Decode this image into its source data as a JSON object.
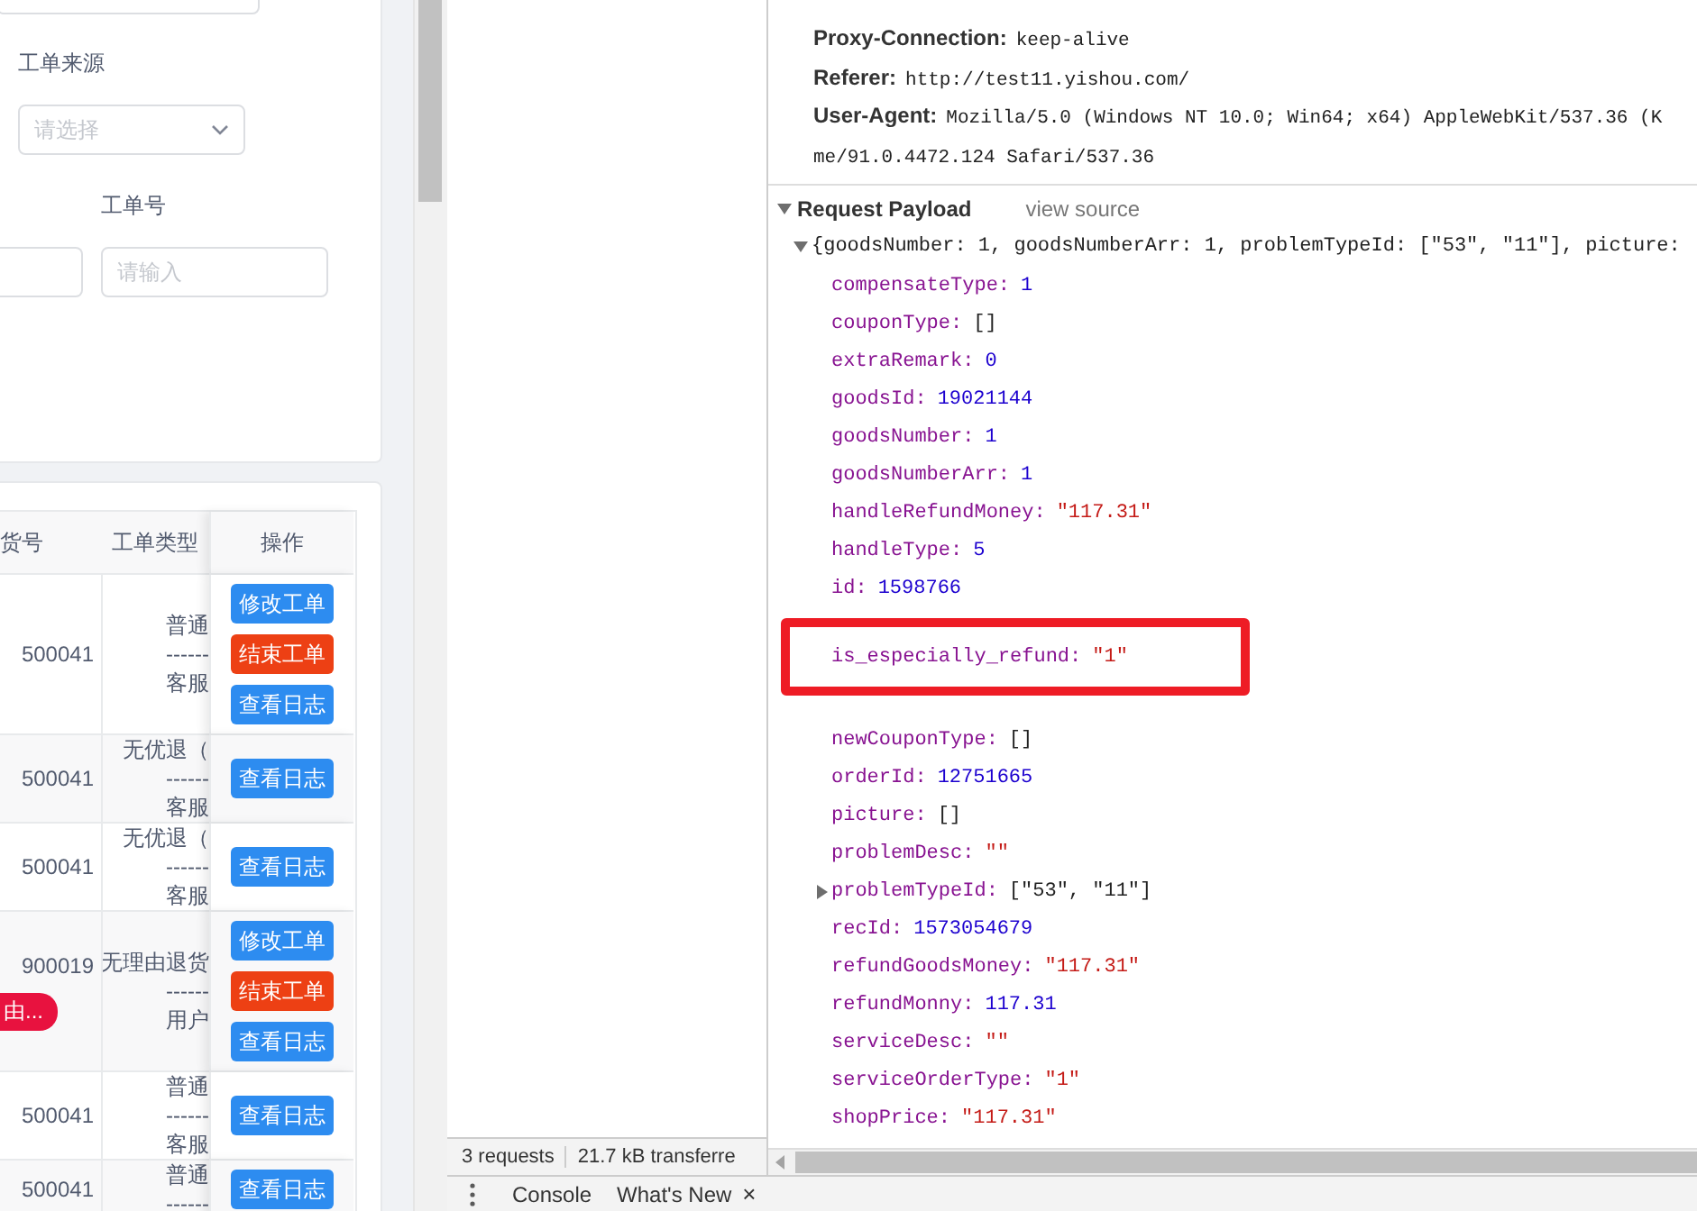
{
  "app": {
    "form": {
      "fields": [
        {
          "label": "工单来源",
          "placeholder": "请选择",
          "kind": "select"
        },
        {
          "label": "工单号",
          "placeholder": "请输入",
          "kind": "input"
        }
      ]
    },
    "table": {
      "columns": [
        "货号",
        "工单类型",
        "操作"
      ],
      "rows": [
        {
          "column_1": "500041",
          "type_lines": [
            "普通",
            "------",
            "客服"
          ],
          "actions": [
            {
              "label": "修改工单",
              "kind": "primary"
            },
            {
              "label": "结束工单",
              "kind": "danger"
            },
            {
              "label": "查看日志",
              "kind": "primary"
            }
          ]
        },
        {
          "column_1": "500041",
          "type_lines": [
            "无优退（",
            "------",
            "客服"
          ],
          "actions": [
            {
              "label": "查看日志",
              "kind": "primary"
            }
          ]
        },
        {
          "column_1": "500041",
          "type_lines": [
            "无优退（",
            "------",
            "客服"
          ],
          "actions": [
            {
              "label": "查看日志",
              "kind": "primary"
            }
          ]
        },
        {
          "column_1": "900019",
          "tag": "由...",
          "type_lines": [
            "无理由退货",
            "------",
            "用户"
          ],
          "actions": [
            {
              "label": "修改工单",
              "kind": "primary"
            },
            {
              "label": "结束工单",
              "kind": "danger"
            },
            {
              "label": "查看日志",
              "kind": "primary"
            }
          ]
        },
        {
          "column_1": "500041",
          "type_lines": [
            "普通",
            "------",
            "客服"
          ],
          "actions": [
            {
              "label": "查看日志",
              "kind": "primary"
            }
          ]
        },
        {
          "column_1": "500041",
          "type_lines": [
            "普通",
            "------"
          ],
          "actions": [
            {
              "label": "查看日志",
              "kind": "primary"
            }
          ]
        }
      ]
    }
  },
  "network": {
    "status_bar": [
      "3 requests",
      "21.7 kB transferre"
    ]
  },
  "headers": [
    {
      "key": "Proxy-Connection:",
      "value": "keep-alive"
    },
    {
      "key": "Referer:",
      "value": "http://test11.yishou.com/"
    },
    {
      "key": "User-Agent:",
      "value": "Mozilla/5.0 (Windows NT 10.0; Win64; x64) AppleWebKit/537.36 (K"
    },
    {
      "value": "me/91.0.4472.124 Safari/537.36"
    }
  ],
  "payload": {
    "title": "Request Payload",
    "link": "view source",
    "expanded": true,
    "summary": "{goodsNumber: 1, goodsNumberArr: 1, problemTypeId: [\"53\", \"11\"], picture:",
    "summary_expanded": true,
    "properties": [
      {
        "key": "compensateType:",
        "value": "1",
        "kind": "number",
        "expandable": false,
        "highlighted": false
      },
      {
        "key": "couponType:",
        "value": "[]",
        "kind": "array",
        "expandable": false,
        "highlighted": false
      },
      {
        "key": "extraRemark:",
        "value": "0",
        "kind": "number",
        "expandable": false,
        "highlighted": false
      },
      {
        "key": "goodsId:",
        "value": "19021144",
        "kind": "number",
        "expandable": false,
        "highlighted": false
      },
      {
        "key": "goodsNumber:",
        "value": "1",
        "kind": "number",
        "expandable": false,
        "highlighted": false
      },
      {
        "key": "goodsNumberArr:",
        "value": "1",
        "kind": "number",
        "expandable": false,
        "highlighted": false
      },
      {
        "key": "handleRefundMoney:",
        "value": "\"117.31\"",
        "kind": "string",
        "expandable": false,
        "highlighted": false
      },
      {
        "key": "handleType:",
        "value": "5",
        "kind": "number",
        "expandable": false,
        "highlighted": false
      },
      {
        "key": "id:",
        "value": "1598766",
        "kind": "number",
        "expandable": false,
        "highlighted": false
      },
      {
        "key": "is_especially_refund:",
        "value": "\"1\"",
        "kind": "string",
        "expandable": false,
        "highlighted": true
      },
      {
        "key": "newCouponType:",
        "value": "[]",
        "kind": "array",
        "expandable": false,
        "highlighted": false
      },
      {
        "key": "orderId:",
        "value": "12751665",
        "kind": "number",
        "expandable": false,
        "highlighted": false
      },
      {
        "key": "picture:",
        "value": "[]",
        "kind": "array",
        "expandable": false,
        "highlighted": false
      },
      {
        "key": "problemDesc:",
        "value": "\"\"",
        "kind": "string",
        "expandable": false,
        "highlighted": false
      },
      {
        "key": "problemTypeId:",
        "value": "[\"53\", \"11\"]",
        "kind": "array",
        "expandable": true,
        "highlighted": false
      },
      {
        "key": "recId:",
        "value": "1573054679",
        "kind": "number",
        "expandable": false,
        "highlighted": false
      },
      {
        "key": "refundGoodsMoney:",
        "value": "\"117.31\"",
        "kind": "string",
        "expandable": false,
        "highlighted": false
      },
      {
        "key": "refundMonny:",
        "value": "117.31",
        "kind": "number",
        "expandable": false,
        "highlighted": false
      },
      {
        "key": "serviceDesc:",
        "value": "\"\"",
        "kind": "string",
        "expandable": false,
        "highlighted": false
      },
      {
        "key": "serviceOrderType:",
        "value": "\"1\"",
        "kind": "string",
        "expandable": false,
        "highlighted": false
      },
      {
        "key": "shopPrice:",
        "value": "\"117.31\"",
        "kind": "string",
        "expandable": false,
        "highlighted": false
      }
    ]
  },
  "drawer": {
    "tabs": [
      "Console",
      "What's New"
    ],
    "close": "×"
  }
}
